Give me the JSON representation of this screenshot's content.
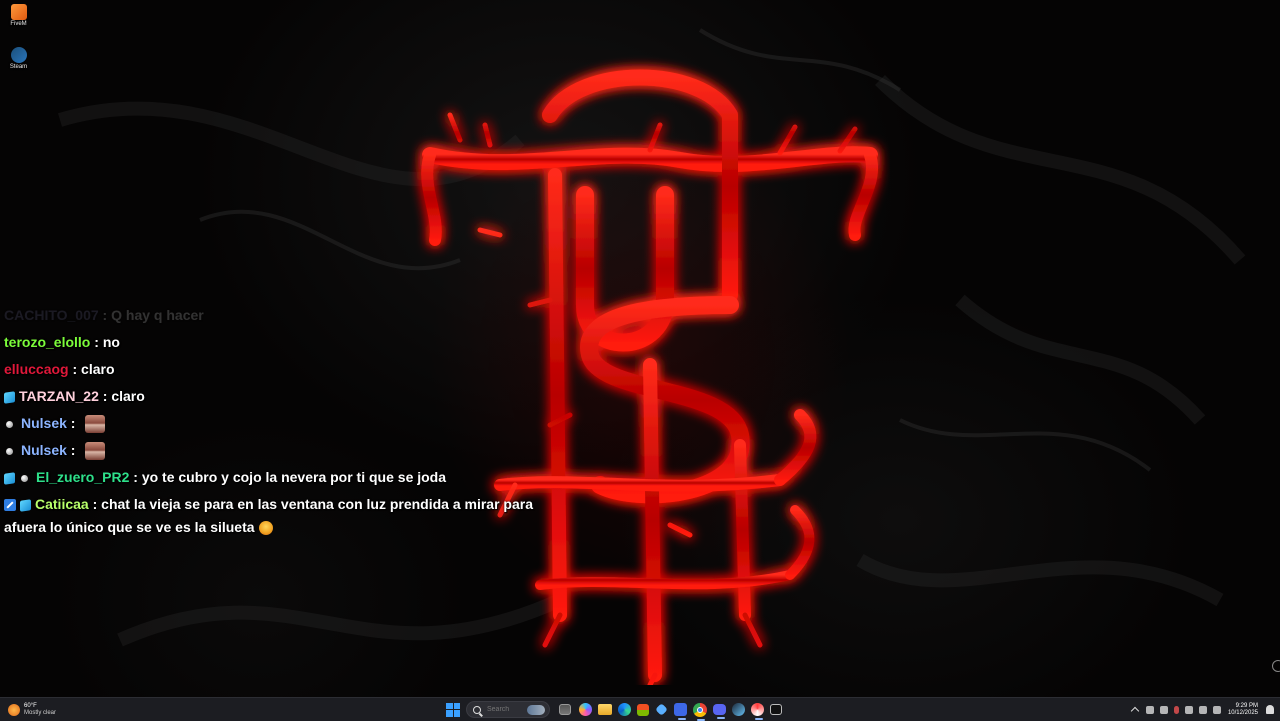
{
  "desktop": {
    "icons": [
      {
        "label": "FiveM",
        "icon": "fivem-icon"
      },
      {
        "label": "Steam",
        "icon": "steam-icon"
      }
    ]
  },
  "chat": {
    "messages": [
      {
        "user": "CACHITO_007",
        "sep": " : ",
        "text": "Q hay q hacer",
        "badges": [],
        "faded": true
      },
      {
        "user": "terozo_elollo",
        "sep": " : ",
        "text": "no",
        "badges": []
      },
      {
        "user": "elluccaog",
        "sep": " : ",
        "text": "claro",
        "badges": []
      },
      {
        "user": "TARZAN_22",
        "sep": " : ",
        "text": "claro",
        "badges": [
          "subscriber-badge-icon"
        ]
      },
      {
        "user": "Nulsek",
        "sep": " : ",
        "text": "",
        "badges": [
          "gray-dot-badge-icon"
        ],
        "emote": "emote-icon"
      },
      {
        "user": "Nulsek",
        "sep": " : ",
        "text": "",
        "badges": [
          "gray-dot-badge-icon"
        ],
        "emote": "emote-icon"
      },
      {
        "user": "El_zuero_PR2",
        "sep": " : ",
        "text": "yo te cubro y cojo la nevera por ti que se joda",
        "badges": [
          "subscriber-badge-icon",
          "gray-dot-badge-icon"
        ]
      },
      {
        "user": "Catiicaa",
        "sep": " : ",
        "text": "chat la vieja se para en las ventana con luz prendida a mirar para afuera lo único que se ve es la silueta",
        "badges": [
          "moderator-badge-icon",
          "subscriber-badge-icon"
        ],
        "emoji": "smiling-emoji-icon"
      }
    ]
  },
  "taskbar": {
    "weather": {
      "temp": "60°F",
      "condition": "Mostly clear"
    },
    "search": {
      "placeholder": "Search"
    },
    "clock": {
      "time": "9:29 PM",
      "date": "10/12/2025"
    },
    "accent": "#3aa0ff"
  },
  "colors": {
    "wallpaper_bg": "#050404",
    "logo_red": "#d00000",
    "taskbar_bg": "#1c1d22"
  }
}
